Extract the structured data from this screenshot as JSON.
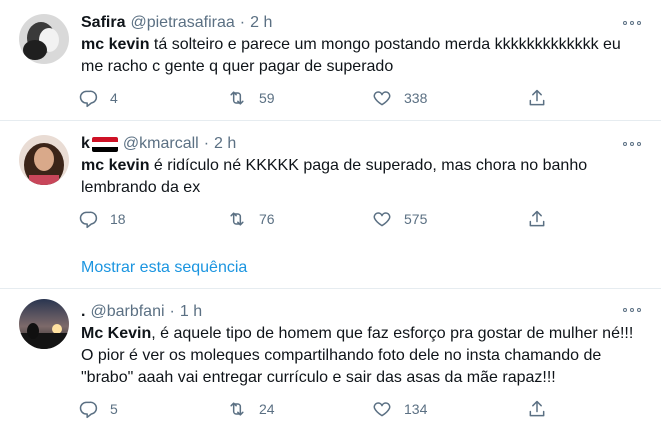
{
  "tweets": [
    {
      "name": "Safira",
      "handle": "@pietrasafiraa",
      "dot": "·",
      "time": "2 h",
      "mention": "mc kevin",
      "text": " tá solteiro e parece um mongo postando merda kkkkkkkkkkkkk eu me racho c gente q quer pagar de superado",
      "replies": "4",
      "retweets": "59",
      "likes": "338"
    },
    {
      "name": "k",
      "handle": "@kmarcall",
      "dot": "·",
      "time": "2 h",
      "flag_colors": [
        "#ce1126",
        "#ffffff",
        "#000000"
      ],
      "mention": "mc kevin",
      "text": " é ridículo né KKKKK paga de superado, mas chora no banho lembrando da ex",
      "replies": "18",
      "retweets": "76",
      "likes": "575",
      "show_thread": "Mostrar esta sequência"
    },
    {
      "name": ".",
      "handle": "@barbfani",
      "dot": "·",
      "time": "1 h",
      "mention": "Mc Kevin",
      "text": ", é aquele tipo de homem que faz esforço pra gostar de mulher né!!! O pior é ver os moleques compartilhando foto dele no insta chamando de \"brabo\" aaah vai entregar currículo e sair das asas da mãe rapaz!!!",
      "replies": "5",
      "retweets": "24",
      "likes": "134"
    }
  ],
  "icons": {
    "reply": "reply-icon",
    "retweet": "retweet-icon",
    "like": "like-icon",
    "share": "share-icon",
    "more": "more-icon"
  },
  "colors": {
    "text": "#0f1419",
    "secondary": "#5b7083",
    "link": "#1b95e0",
    "divider": "#e6ecf0"
  }
}
